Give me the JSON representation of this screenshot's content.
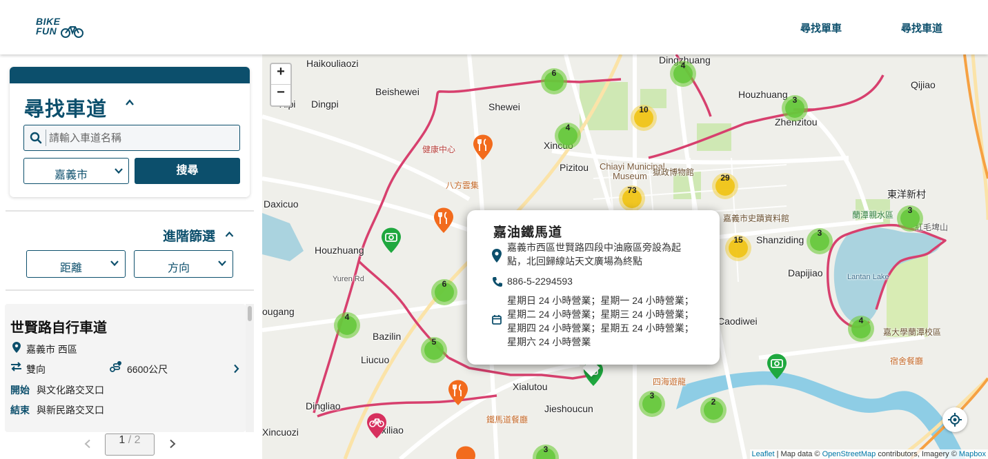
{
  "header": {
    "logo_line1": "BIKE",
    "logo_line2": "FUN",
    "nav_find_bike": "尋找單車",
    "nav_find_route": "尋找車道"
  },
  "search": {
    "title": "尋找車道",
    "placeholder": "請輸入車道名稱",
    "city": "嘉義市",
    "button": "搜尋"
  },
  "advanced": {
    "label": "進階篩選",
    "distance": "距離",
    "direction": "方向"
  },
  "route_card": {
    "name": "世賢路自行車道",
    "location": "嘉義市 西區",
    "direction": "雙向",
    "length": "6600公尺",
    "start_label": "開始",
    "start_value": "與文化路交叉口",
    "end_label": "結束",
    "end_value": "與新民路交叉口"
  },
  "pagination": {
    "current": "1",
    "separator": "/",
    "total": "2"
  },
  "map": {
    "zoom_in": "+",
    "zoom_out": "−",
    "attribution_leaflet": "Leaflet",
    "attribution_mid": " | Map data © ",
    "attribution_osm": "OpenStreetMap",
    "attribution_contrib": " contributors, Imagery © ",
    "attribution_mapbox": "Mapbox",
    "route_color": "#d7406e",
    "places": [
      {
        "id": "haikouliaozi",
        "text": "Haikouliaozi"
      },
      {
        "id": "dingzhuang",
        "text": "Dingzhuang"
      },
      {
        "id": "beishewei",
        "text": "Beishewei"
      },
      {
        "id": "xipi",
        "text": "Xipi"
      },
      {
        "id": "dingpi",
        "text": "Dingpi"
      },
      {
        "id": "shewei",
        "text": "Shewei"
      },
      {
        "id": "houzhuang1",
        "text": "Houzhuang"
      },
      {
        "id": "qijiao",
        "text": "Qijiao"
      },
      {
        "id": "zhenzitou",
        "text": "Zhenzitou"
      },
      {
        "id": "xincuo",
        "text": "Xincuo"
      },
      {
        "id": "pizitou",
        "text": "Pizitou"
      },
      {
        "id": "museum1",
        "text": "Chiayi Municipal"
      },
      {
        "id": "museum2",
        "text": "Museum"
      },
      {
        "id": "daxicuo",
        "text": "Daxicuo"
      },
      {
        "id": "houzhuang2",
        "text": "Houzhuang"
      },
      {
        "id": "yurenrd",
        "text": "Yuren Rd"
      },
      {
        "id": "ougang",
        "text": "ougang"
      },
      {
        "id": "bazilin",
        "text": "Bazilin"
      },
      {
        "id": "liucuo",
        "text": "Liucuo"
      },
      {
        "id": "dingliao",
        "text": "Dingliao"
      },
      {
        "id": "xincuozi",
        "text": "Xincuozi"
      },
      {
        "id": "xialiao",
        "text": "xiliao"
      },
      {
        "id": "xialutou",
        "text": "Xialutou"
      },
      {
        "id": "jieshoucun",
        "text": "Jieshoucun"
      },
      {
        "id": "shanziding",
        "text": "Shanziding"
      },
      {
        "id": "dapijiao",
        "text": "Dapijiao"
      },
      {
        "id": "caodiwei",
        "text": "Caodiwei"
      },
      {
        "id": "dongyang",
        "text": "東洋新村"
      },
      {
        "id": "lantan",
        "text": "Lantan Lake"
      },
      {
        "id": "jianguo",
        "text": "嘉義市史蹟資料館"
      },
      {
        "id": "yumin",
        "text": "獄政博物館"
      },
      {
        "id": "health",
        "text": "健康中心"
      },
      {
        "id": "bafang",
        "text": "八方雲集"
      },
      {
        "id": "tiedao",
        "text": "鐵馬道餐廳"
      },
      {
        "id": "sihai",
        "text": "四海遊龍"
      },
      {
        "id": "sushe",
        "text": "宿舍餐廳"
      },
      {
        "id": "lantanschool",
        "text": "嘉大學蘭潭校區"
      },
      {
        "id": "hongmao",
        "text": "紅毛埤山"
      },
      {
        "id": "lanlake",
        "text": "蘭潭親水區"
      }
    ],
    "clusters": [
      {
        "id": "c-6a",
        "count": "6",
        "color": "green"
      },
      {
        "id": "c-4a",
        "count": "4",
        "color": "green"
      },
      {
        "id": "c-4b",
        "count": "4",
        "color": "green"
      },
      {
        "id": "c-10",
        "count": "10",
        "color": "yellow"
      },
      {
        "id": "c-3a",
        "count": "3",
        "color": "green"
      },
      {
        "id": "c-29",
        "count": "29",
        "color": "yellow"
      },
      {
        "id": "c-73",
        "count": "73",
        "color": "yellow"
      },
      {
        "id": "c-15",
        "count": "15",
        "color": "yellow"
      },
      {
        "id": "c-3b",
        "count": "3",
        "color": "green"
      },
      {
        "id": "c-3c",
        "count": "3",
        "color": "green"
      },
      {
        "id": "c-6b",
        "count": "6",
        "color": "green"
      },
      {
        "id": "c-4c",
        "count": "4",
        "color": "green"
      },
      {
        "id": "c-4d",
        "count": "4",
        "color": "green"
      },
      {
        "id": "c-5",
        "count": "5",
        "color": "green"
      },
      {
        "id": "c-3d",
        "count": "3",
        "color": "green"
      },
      {
        "id": "c-2",
        "count": "2",
        "color": "green"
      },
      {
        "id": "c-3e",
        "count": "3",
        "color": "green"
      }
    ]
  },
  "popup": {
    "title": "嘉油鐵馬道",
    "address": "嘉義市西區世賢路四段中油廠區旁設為起點，北回歸線站天文廣場為終點",
    "address_line1": "嘉義市西區世賢路四段中油廠區旁設為起",
    "address_line2": "點，北回歸線站天文廣場為終點",
    "phone": "886-5-2294593",
    "hours_line1": "星期日 24 小時營業；星期一 24 小時營業；",
    "hours_line2": "星期二 24 小時營業；星期三 24 小時營業；",
    "hours_line3": "星期四 24 小時營業；星期五 24 小時營業；",
    "hours_line4": "星期六 24 小時營業"
  },
  "colors": {
    "brand": "#0c4f6c",
    "route": "#d7406e",
    "marker_food": "#f26b1d",
    "marker_spot": "#1fa83f"
  }
}
